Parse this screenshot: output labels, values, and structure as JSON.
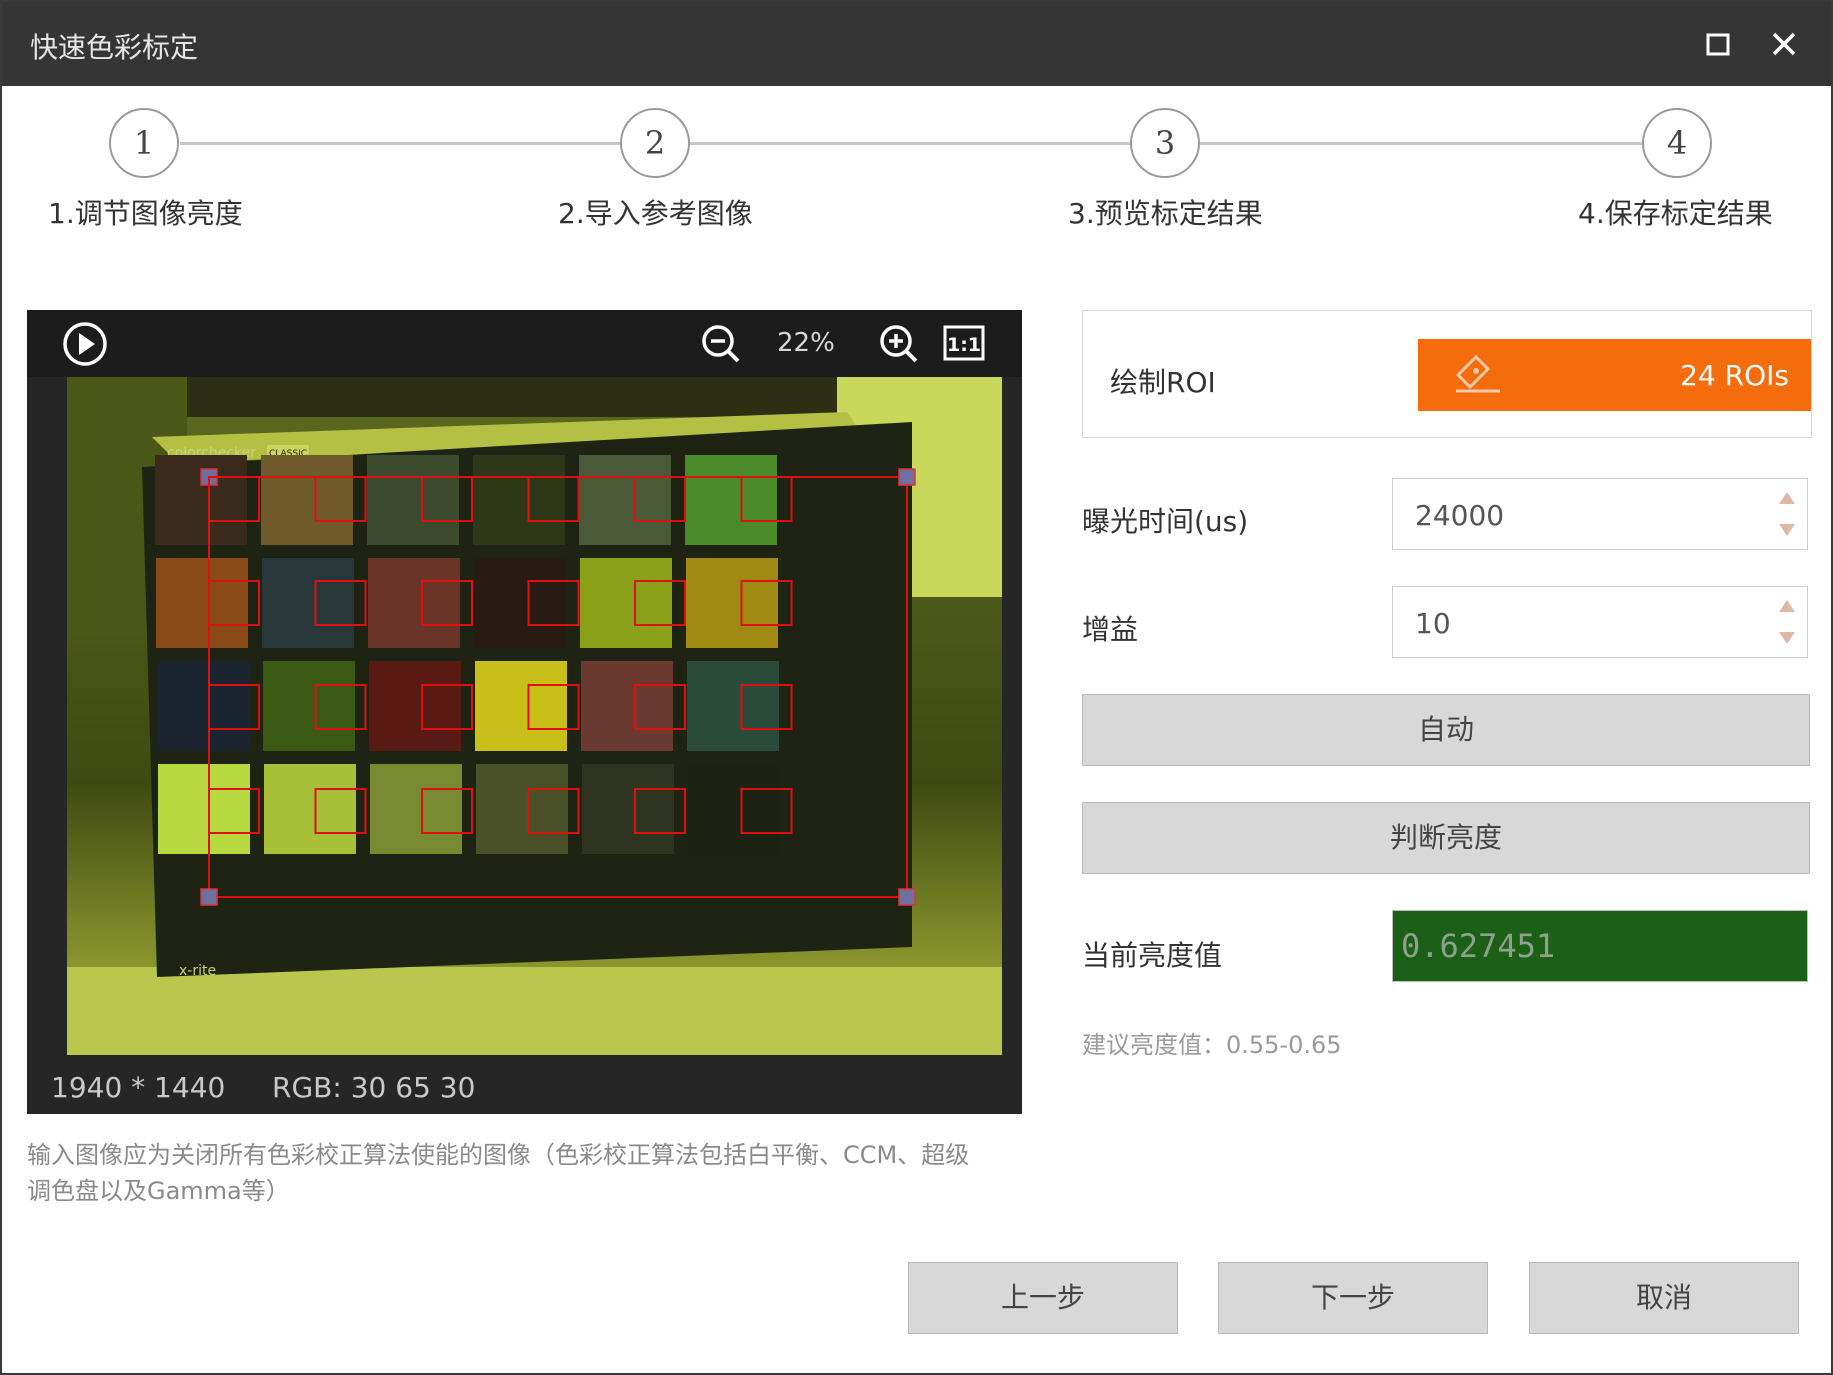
{
  "window": {
    "title": "快速色彩标定",
    "maximize_icon": "maximize-icon",
    "close_icon": "close-icon"
  },
  "steps": [
    {
      "number": "1",
      "label": "1.调节图像亮度"
    },
    {
      "number": "2",
      "label": "2.导入参考图像"
    },
    {
      "number": "3",
      "label": "3.预览标定结果"
    },
    {
      "number": "4",
      "label": "4.保存标定结果"
    }
  ],
  "viewer": {
    "play_icon": "play-icon",
    "zoom_out_icon": "zoom-out-icon",
    "zoom_level": "22%",
    "zoom_in_icon": "zoom-in-icon",
    "actual_size_label": "1:1",
    "image": {
      "chart_brand": "colorchecker",
      "chart_badge": "CLASSIC",
      "chart_maker": "x-rite",
      "roi_count": 24,
      "roi_color": "#e01010"
    },
    "resolution": "1940 * 1440",
    "rgb": "RGB: 30 65 30"
  },
  "note": "输入图像应为关闭所有色彩校正算法使能的图像（色彩校正算法包括白平衡、CCM、超级调色盘以及Gamma等）",
  "roi": {
    "label": "绘制ROI",
    "icon": "draw-roi-icon",
    "count_text": "24 ROIs",
    "accent": "#f46c0c"
  },
  "exposure": {
    "label": "曝光时间(us)",
    "value": "24000"
  },
  "gain": {
    "label": "增益",
    "value": "10"
  },
  "buttons": {
    "auto": "自动",
    "judge_brightness": "判断亮度",
    "previous": "上一步",
    "next": "下一步",
    "cancel": "取消"
  },
  "brightness": {
    "label": "当前亮度值",
    "value": "0.627451",
    "bg_color": "#1b6016",
    "hint": "建议亮度值：0.55-0.65"
  }
}
